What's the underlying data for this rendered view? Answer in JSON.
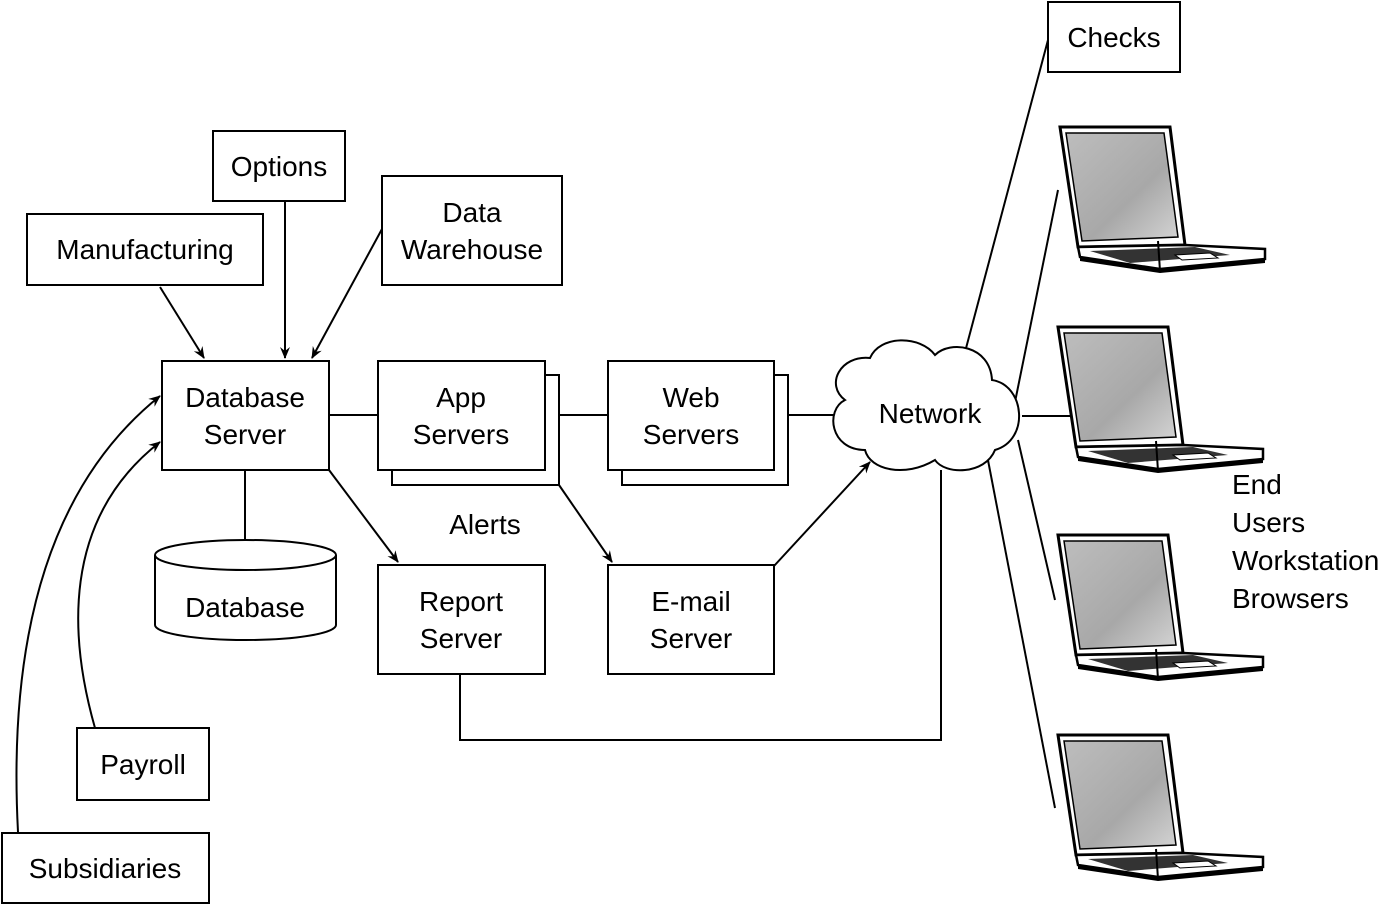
{
  "nodes": {
    "checks": "Checks",
    "options": "Options",
    "manufacturing": "Manufacturing",
    "data_warehouse": [
      "Data",
      "Warehouse"
    ],
    "database_server": [
      "Database",
      "Server"
    ],
    "app_servers": [
      "App",
      "Servers"
    ],
    "web_servers": [
      "Web",
      "Servers"
    ],
    "network": "Network",
    "database": "Database",
    "report_server": [
      "Report",
      "Server"
    ],
    "email_server": [
      "E-mail",
      "Server"
    ],
    "payroll": "Payroll",
    "subsidiaries": "Subsidiaries"
  },
  "labels": {
    "alerts": "Alerts",
    "end_users": [
      "End",
      "Users",
      "Workstation",
      "Browsers"
    ]
  },
  "icons": {
    "laptop": "laptop-icon",
    "cloud": "cloud-icon"
  }
}
